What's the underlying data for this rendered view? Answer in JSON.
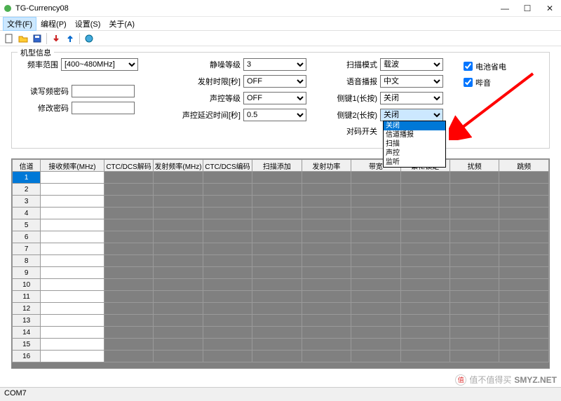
{
  "window": {
    "title": "TG-Currency08"
  },
  "menu": {
    "file": "文件(F)",
    "program": "编程(P)",
    "settings": "设置(S)",
    "about": "关于(A)"
  },
  "fieldset": {
    "legend": "机型信息",
    "freq_range_label": "频率范围",
    "freq_range_value": "[400~480MHz]",
    "rw_pwd_label": "读写频密码",
    "mod_pwd_label": "修改密码",
    "squelch_label": "静噪等级",
    "squelch_value": "3",
    "tot_label": "发射时限[秒]",
    "tot_value": "OFF",
    "vox_label": "声控等级",
    "vox_value": "OFF",
    "vox_delay_label": "声控延迟时间[秒]",
    "vox_delay_value": "0.5",
    "scan_mode_label": "扫描模式",
    "scan_mode_value": "载波",
    "voice_label": "语音播报",
    "voice_value": "中文",
    "side1_label": "侧键1(长按)",
    "side1_value": "关闭",
    "side2_label": "侧键2(长按)",
    "side2_value": "关闭",
    "pair_label": "对码开关",
    "save_label": "电池省电",
    "beep_label": "哔音"
  },
  "dropdown": {
    "opt_off": "关闭",
    "opt_chan": "信道播报",
    "opt_scan": "扫描",
    "opt_vox": "声控",
    "opt_mon": "监听"
  },
  "grid": {
    "headers": [
      "信道",
      "接收频率(MHz)",
      "CTC/DCS解码",
      "发射频率(MHz)",
      "CTC/DCS编码",
      "扫描添加",
      "发射功率",
      "带宽",
      "繁忙锁定",
      "扰频",
      "跳频"
    ],
    "rows": [
      "1",
      "2",
      "3",
      "4",
      "5",
      "6",
      "7",
      "8",
      "9",
      "10",
      "11",
      "12",
      "13",
      "14",
      "15",
      "16"
    ]
  },
  "status": {
    "com": "COM7"
  },
  "watermark": {
    "text": "值不值得买",
    "site": "SMYZ.NET"
  }
}
